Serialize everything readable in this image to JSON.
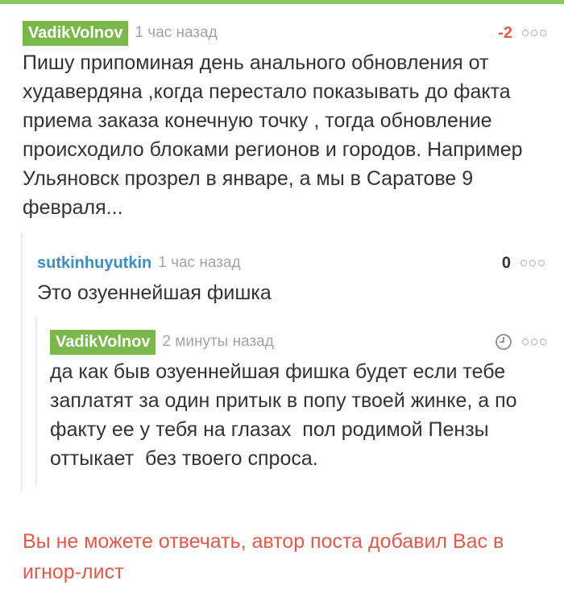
{
  "colors": {
    "accent_green": "#8ac858",
    "badge_green": "#7bb84b",
    "username_blue": "#3c8ec8",
    "negative_red": "#e05a4a",
    "text": "#333333",
    "muted": "#a4a4a4"
  },
  "comments": [
    {
      "author": "VadikVolnov",
      "time": "1 час назад",
      "rating": "-2",
      "icon": "more-dots-icon",
      "text": "Пишу припоминая день анального обновления от худавердяна ,когда перестало показывать до факта приема заказа конечную точку , тогда обновление происходило блоками регионов и городов. Например Ульяновск прозрел в январе, а мы в Саратове 9 февраля..."
    },
    {
      "author": "sutkinhuyutkin",
      "time": "1 час назад",
      "rating": "0",
      "icon": "more-dots-icon",
      "text": "Это озуеннейшая фишка"
    },
    {
      "author": "VadikVolnov",
      "time": "2 минуты назад",
      "icon": "clock-icon",
      "text": "да как быв озуеннейшая фишка будет если тебе заплатят за один притык в попу твоей жинке, а по факту ее у тебя на глазах  пол родимой Пензы оттыкает  без твоего спроса."
    }
  ],
  "notice": "Вы не можете отвечать, автор поста добавил Вас в игнор-лист"
}
